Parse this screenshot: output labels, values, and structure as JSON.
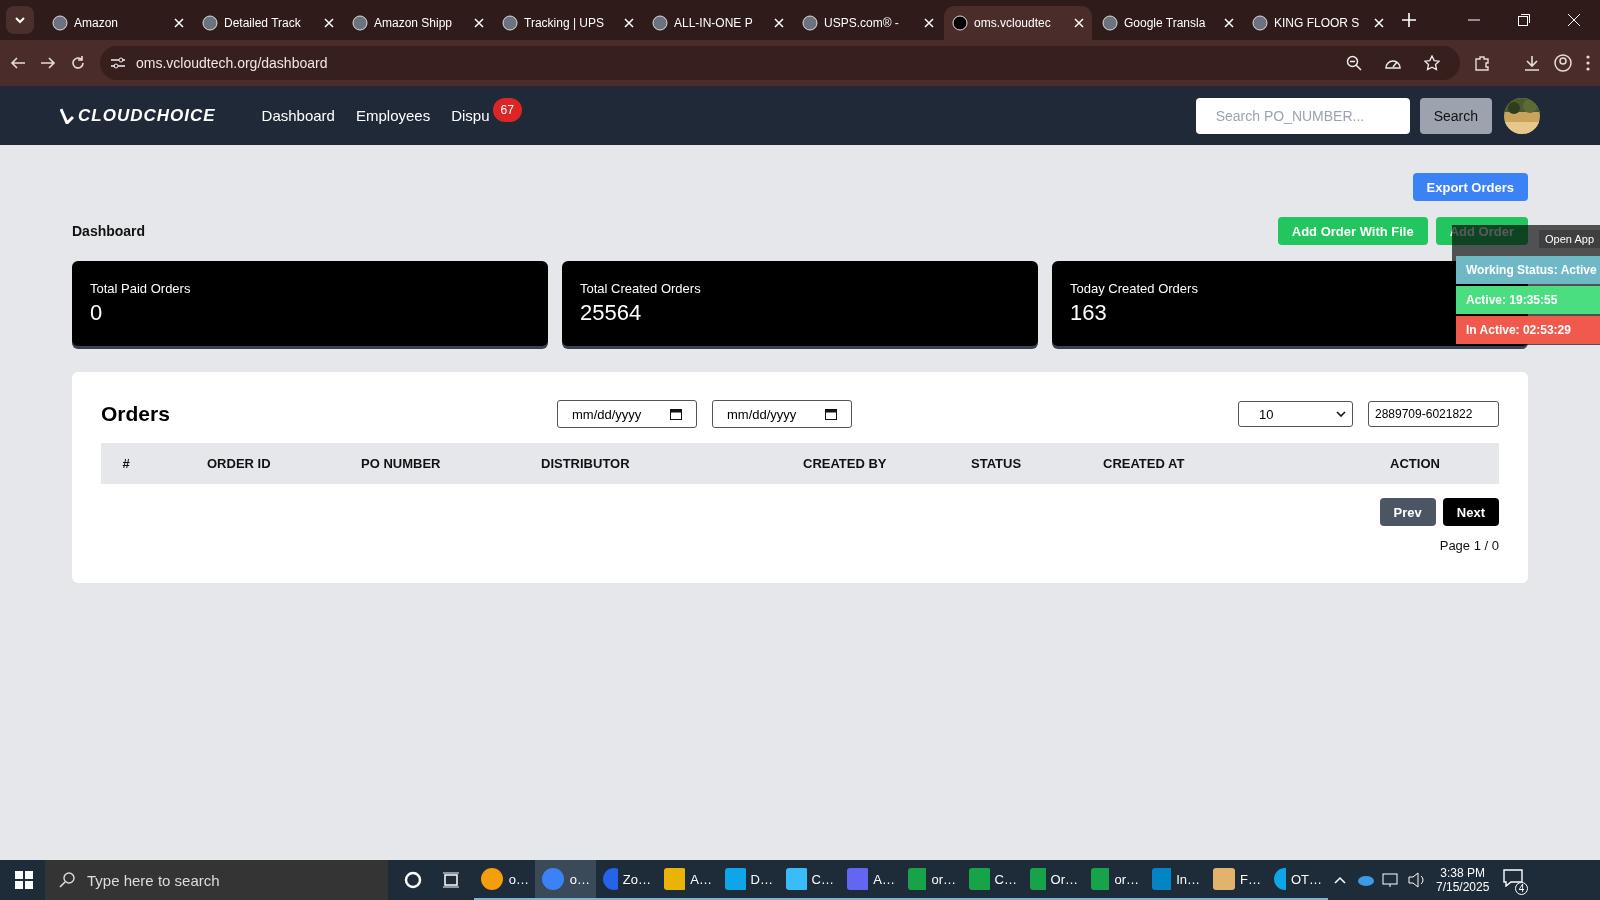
{
  "browser": {
    "tabs": [
      {
        "title": "Amazon",
        "selected": false
      },
      {
        "title": "Detailed Track",
        "selected": false
      },
      {
        "title": "Amazon Shipp",
        "selected": false
      },
      {
        "title": "Tracking | UPS",
        "selected": false
      },
      {
        "title": "ALL-IN-ONE P",
        "selected": false
      },
      {
        "title": "USPS.com® - ",
        "selected": false
      },
      {
        "title": "oms.vcloudtec",
        "selected": true
      },
      {
        "title": "Google Transla",
        "selected": false
      },
      {
        "title": "KING FLOOR S",
        "selected": false
      }
    ],
    "address": "oms.vcloudtech.org/dashboard"
  },
  "header": {
    "logo": "CLOUDCHOICE",
    "nav": [
      {
        "label": "Dashboard"
      },
      {
        "label": "Employees"
      },
      {
        "label": "Dispu",
        "badge": "67"
      }
    ],
    "search": {
      "placeholder": "Search PO_NUMBER..."
    },
    "search_button": "Search"
  },
  "page": {
    "title": "Dashboard",
    "export_button": "Export Orders",
    "add_file_button": "Add Order With File",
    "add_button": "Add Order",
    "stats": [
      {
        "label": "Total Paid Orders",
        "value": "0"
      },
      {
        "label": "Total Created Orders",
        "value": "25564"
      },
      {
        "label": "Today Created Orders",
        "value": "163"
      }
    ]
  },
  "orders": {
    "title": "Orders",
    "date_from": {
      "placeholder": "mm/dd/yyyy"
    },
    "date_to": {
      "placeholder": "mm/dd/yyyy"
    },
    "page_size": "10",
    "search": {
      "value": "2889709-6021822"
    },
    "columns": [
      "#",
      "ORDER ID",
      "PO NUMBER",
      "DISTRIBUTOR",
      "CREATED BY",
      "STATUS",
      "CREATED AT",
      "ACTION"
    ],
    "prev": "Prev",
    "next": "Next",
    "page_info": "Page 1 / 0"
  },
  "status_widget": {
    "open_app": "Open App",
    "rows": [
      {
        "kind": "status",
        "text": "Working Status: Active"
      },
      {
        "kind": "active",
        "text": "Active: 19:35:55"
      },
      {
        "kind": "inactive",
        "text": "In Active: 02:53:29"
      }
    ]
  },
  "taskbar": {
    "search": {
      "placeholder": "Type here to search"
    },
    "apps": [
      {
        "label": "o…",
        "selected": false
      },
      {
        "label": "o…",
        "selected": true
      },
      {
        "label": "Zo…",
        "selected": false
      },
      {
        "label": "A…",
        "selected": false
      },
      {
        "label": "D…",
        "selected": false
      },
      {
        "label": "C…",
        "selected": false
      },
      {
        "label": "A…",
        "selected": false
      },
      {
        "label": "or…",
        "selected": false
      },
      {
        "label": "C…",
        "selected": false
      },
      {
        "label": "Or…",
        "selected": false
      },
      {
        "label": "or…",
        "selected": false
      },
      {
        "label": "In…",
        "selected": false
      },
      {
        "label": "F…",
        "selected": false
      },
      {
        "label": "OT…",
        "selected": false
      }
    ],
    "time": "3:38 PM",
    "date": "7/15/2025",
    "notifications": "4"
  }
}
